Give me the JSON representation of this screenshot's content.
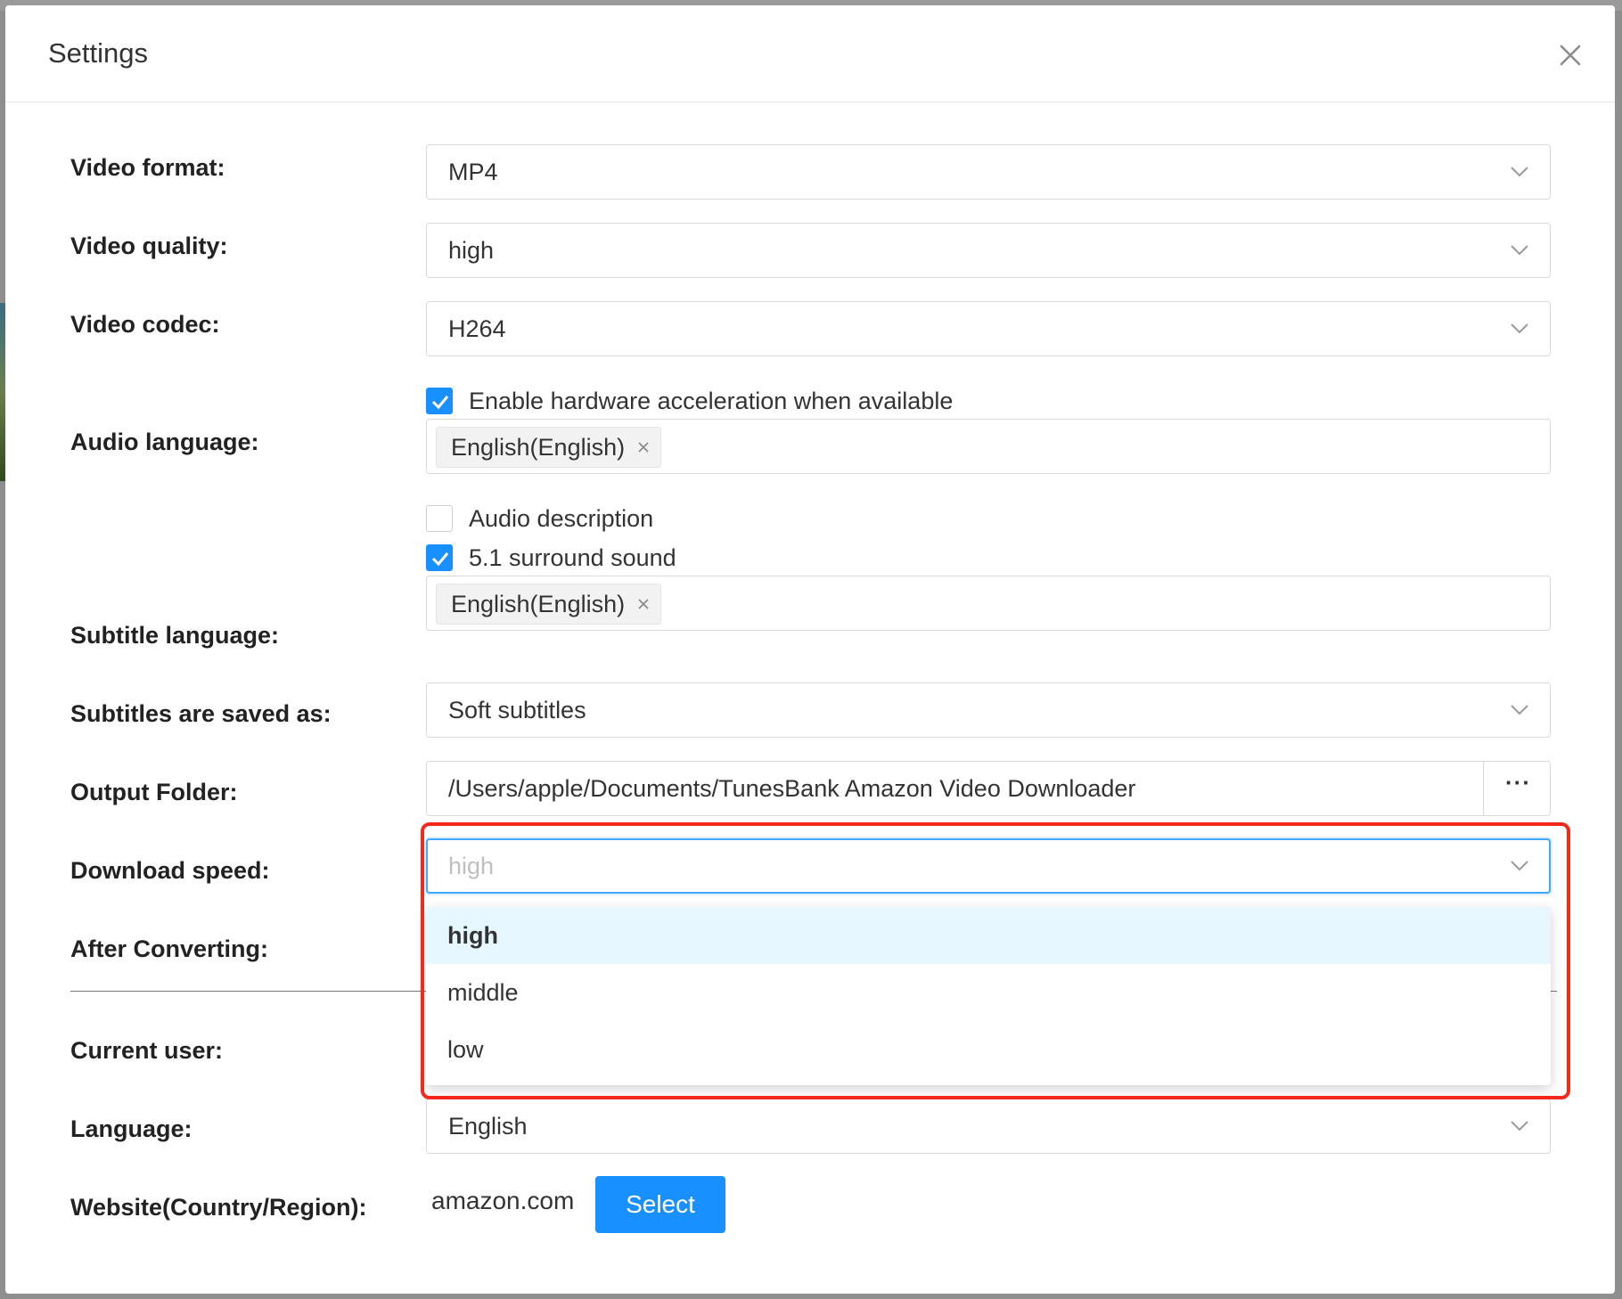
{
  "dialog": {
    "title": "Settings"
  },
  "settings": {
    "video_format": {
      "label": "Video format:",
      "value": "MP4"
    },
    "video_quality": {
      "label": "Video quality:",
      "value": "high"
    },
    "video_codec": {
      "label": "Video codec:",
      "value": "H264"
    },
    "hardware_accel": {
      "label": "Enable hardware acceleration when available",
      "checked": true
    },
    "audio_language": {
      "label": "Audio language:",
      "tags": [
        "English(English)"
      ]
    },
    "audio_description": {
      "label": "Audio description",
      "checked": false
    },
    "surround_sound": {
      "label": "5.1 surround sound",
      "checked": true
    },
    "subtitle_language": {
      "label": "Subtitle language:",
      "tags": [
        "English(English)"
      ]
    },
    "subtitles_saved_as": {
      "label": "Subtitles are saved as:",
      "value": "Soft subtitles"
    },
    "output_folder": {
      "label": "Output Folder:",
      "value": "/Users/apple/Documents/TunesBank Amazon Video Downloader",
      "browse_label": "···"
    },
    "download_speed": {
      "label": "Download speed:",
      "placeholder": "high",
      "options": [
        "high",
        "middle",
        "low"
      ],
      "selected": "high"
    },
    "after_converting": {
      "label": "After Converting:"
    },
    "current_user": {
      "label": "Current user:"
    },
    "language": {
      "label": "Language:",
      "value": "English"
    },
    "website": {
      "label": "Website(Country/Region):",
      "value": "amazon.com",
      "button_label": "Select"
    }
  },
  "colors": {
    "accent": "#1890ff",
    "highlight_border": "#f5281c",
    "option_active_bg": "#e6f7ff"
  },
  "icons": [
    "close-icon",
    "chevron-down-icon",
    "checkmark-icon",
    "tag-remove-icon",
    "ellipsis-icon"
  ]
}
